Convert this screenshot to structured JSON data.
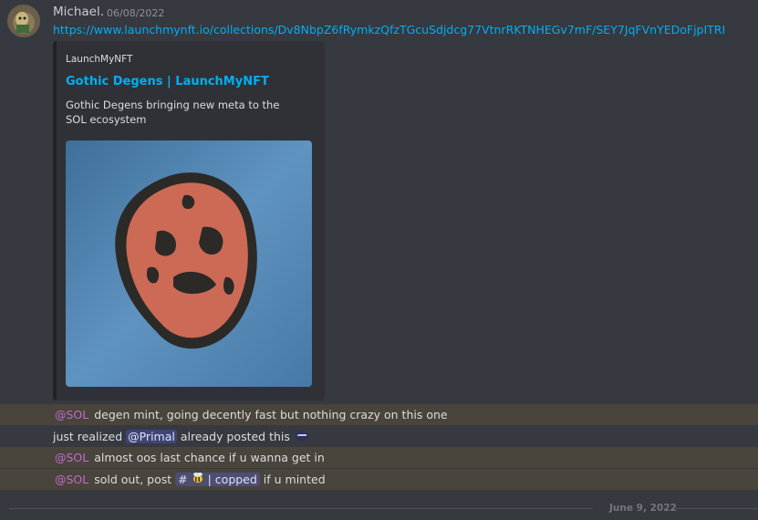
{
  "message": {
    "author": "Michael.",
    "timestamp": "06/08/2022",
    "link": "https://www.launchmynft.io/collections/Dv8NbpZ6fRymkzQfzTGcuSdjdcg77VtnrRKTNHEGv7mF/SEY7JqFVnYEDoFjpITRI"
  },
  "embed": {
    "provider": "LaunchMyNFT",
    "title": "Gothic Degens | LaunchMyNFT",
    "description": "Gothic Degens bringing new meta to the SOL ecosystem",
    "image_icon": "gothic-skull-artwork"
  },
  "followups": [
    {
      "mention": "@SOL",
      "text": " degen mint, going decently fast but nothing crazy on this one"
    },
    {
      "pre": "just realized ",
      "mention": "@Primal",
      "text": " already posted this",
      "emoji": "ninja-emoji"
    },
    {
      "mention": "@SOL",
      "text": " almost oos last chance if u wanna get in"
    },
    {
      "mention": "@SOL",
      "text_before": " sold out, post ",
      "channel": "| copped",
      "text_after": " if u minted"
    }
  ],
  "date_divider": "June 9, 2022",
  "colors": {
    "background": "#36393f",
    "highlight": "#49443c",
    "link": "#00aff4",
    "role_mention": "#c26dcc"
  }
}
